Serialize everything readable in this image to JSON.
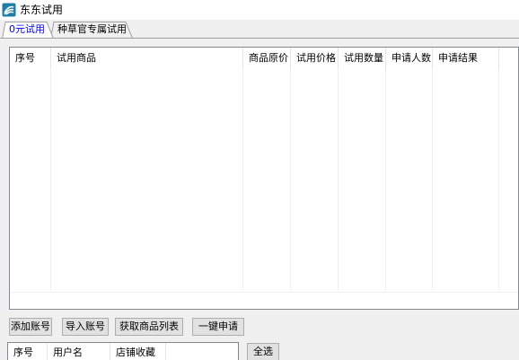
{
  "window": {
    "title": "东东试用",
    "icon": "app-logo-icon"
  },
  "tabs": [
    {
      "label": "0元试用",
      "active": true
    },
    {
      "label": "种草官专属试用",
      "active": false
    }
  ],
  "trial_list": {
    "columns": [
      "序号",
      "试用商品",
      "商品原价",
      "试用价格",
      "试用数量",
      "申请人数",
      "申请结果"
    ],
    "rows": []
  },
  "buttons": {
    "add_account": "添加账号",
    "import_account": "导入账号",
    "fetch_products": "获取商品列表",
    "one_click_apply": "一键申请",
    "select_all": "全选"
  },
  "account_list": {
    "columns": [
      "序号",
      "用户名",
      "店铺收藏"
    ],
    "rows": []
  },
  "colors": {
    "active_tab_text": "#0000ff",
    "window_bg": "#f0f0f0",
    "list_bg": "#ffffff"
  }
}
